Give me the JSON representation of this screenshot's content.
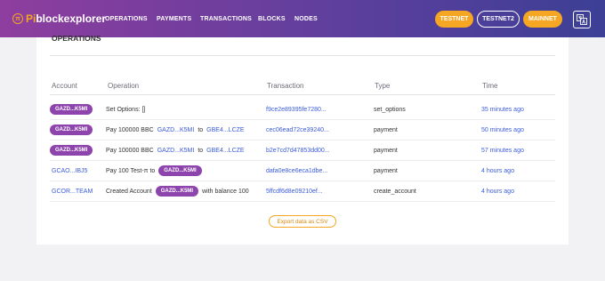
{
  "brand": {
    "logo_glyph": "π",
    "prefix": "Pi",
    "name": "blockexplorer"
  },
  "nav": [
    "OPERATIONS",
    "PAYMENTS",
    "TRANSACTIONS",
    "BLOCKS",
    "NODES"
  ],
  "networks": [
    "TESTNET",
    "TESTNET2",
    "MAINNET"
  ],
  "lang_icon": "translate-icon",
  "section_title": "OPERATIONS",
  "columns": [
    "Account",
    "Operation",
    "Transaction",
    "Type",
    "Time"
  ],
  "rows": [
    {
      "account": "GAZD...K5MI",
      "op": [
        "Set Options: []"
      ],
      "tx": "f9ce2e89395fe7280...",
      "type": "set_options",
      "time": "35 minutes ago"
    },
    {
      "account": "GAZD...K5MI",
      "op": [
        "Pay 100000 BBC",
        "GAZD...K5MI",
        "to",
        "GBE4...LCZE"
      ],
      "tx": "cec06ead72ce39240...",
      "type": "payment",
      "time": "50 minutes ago"
    },
    {
      "account": "GAZD...K5MI",
      "op": [
        "Pay 100000 BBC",
        "GAZD...K5MI",
        "to",
        "GBE4...LCZE"
      ],
      "tx": "b2e7cd7d47853dd00...",
      "type": "payment",
      "time": "57 minutes ago"
    },
    {
      "account": "GCAO...IBJ5",
      "op": [
        "Pay 100 Test-π to",
        "GAZD...K5MI"
      ],
      "tx": "dafa0e8ce6eca1dbe...",
      "type": "payment",
      "time": "4 hours ago"
    },
    {
      "account": "GCOR...TEAM",
      "op": [
        "Created Account",
        "GAZD...K5MI",
        "with balance 100"
      ],
      "tx": "5ffcdf6d8e09210ef...",
      "type": "create_account",
      "time": "4 hours ago"
    }
  ],
  "export_label": "Export data as CSV"
}
